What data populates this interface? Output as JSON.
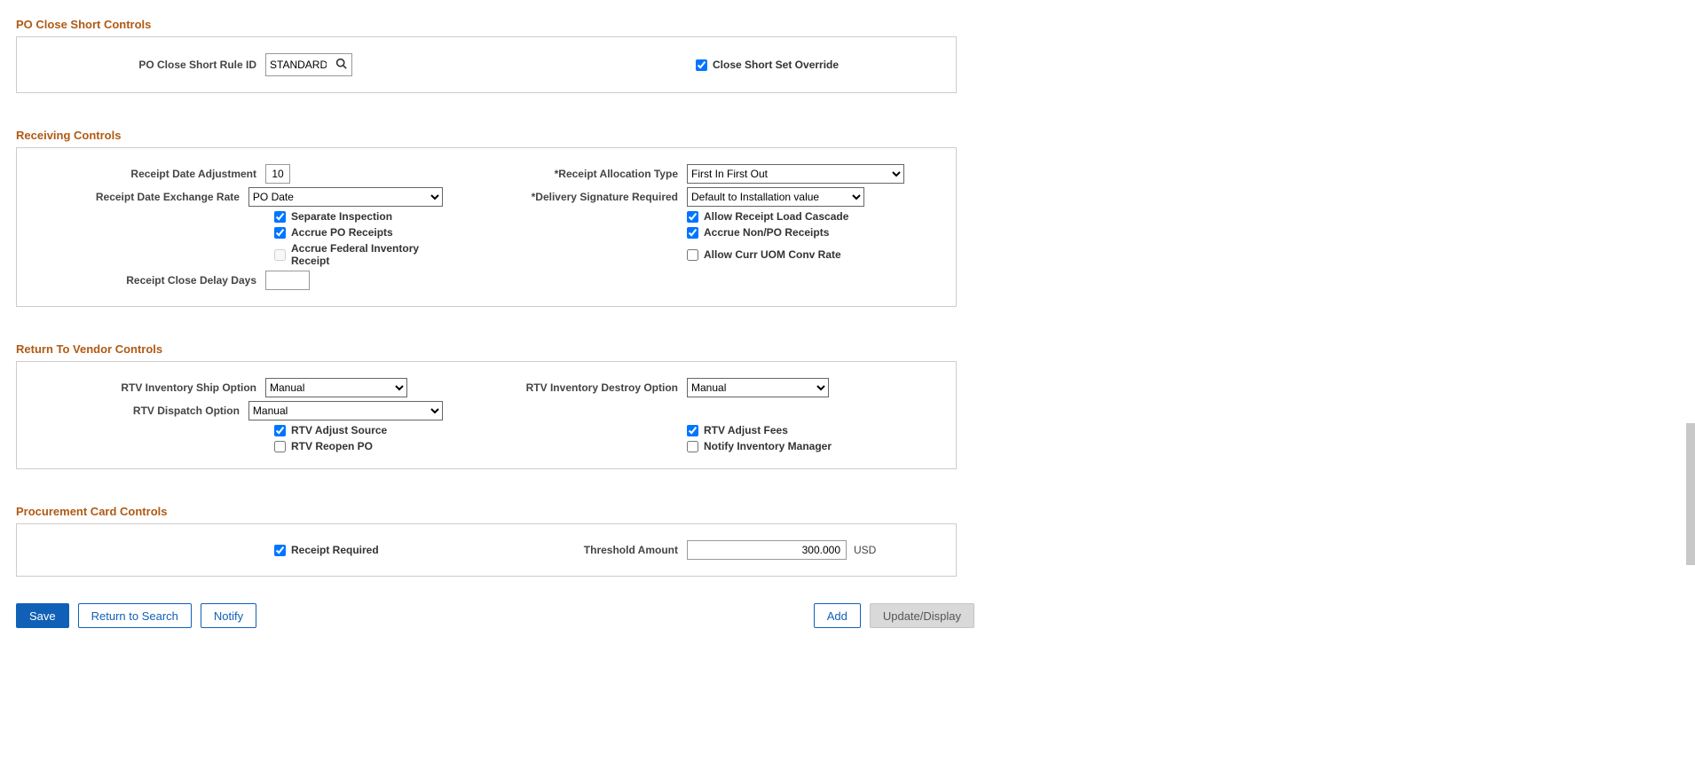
{
  "poCloseShort": {
    "title": "PO Close Short Controls",
    "ruleId_label": "PO Close Short Rule ID",
    "ruleId_value": "STANDARD",
    "closeShortSetOverride_label": "Close Short Set Override",
    "closeShortSetOverride_checked": true
  },
  "receiving": {
    "title": "Receiving Controls",
    "receiptDateAdj_label": "Receipt Date Adjustment",
    "receiptDateAdj_value": "10",
    "receiptAllocType_label": "Receipt Allocation Type",
    "receiptAllocType_value": "First In First Out",
    "receiptDateExchRate_label": "Receipt Date Exchange Rate",
    "receiptDateExchRate_value": "PO Date",
    "deliverySigReq_label": "Delivery Signature Required",
    "deliverySigReq_value": "Default to Installation value",
    "separateInspection_label": "Separate Inspection",
    "separateInspection_checked": true,
    "allowReceiptLoadCascade_label": "Allow Receipt Load Cascade",
    "allowReceiptLoadCascade_checked": true,
    "accruePOReceipts_label": "Accrue PO Receipts",
    "accruePOReceipts_checked": true,
    "accrueNonPOReceipts_label": "Accrue Non/PO Receipts",
    "accrueNonPOReceipts_checked": true,
    "accrueFedInvReceipt_label": "Accrue Federal Inventory Receipt",
    "accrueFedInvReceipt_checked": false,
    "allowCurrUOMConvRate_label": "Allow Curr UOM Conv Rate",
    "allowCurrUOMConvRate_checked": false,
    "receiptCloseDelayDays_label": "Receipt Close Delay Days",
    "receiptCloseDelayDays_value": ""
  },
  "rtv": {
    "title": "Return To Vendor Controls",
    "invShipOption_label": "RTV Inventory Ship Option",
    "invShipOption_value": "Manual",
    "invDestroyOption_label": "RTV Inventory Destroy Option",
    "invDestroyOption_value": "Manual",
    "dispatchOption_label": "RTV Dispatch Option",
    "dispatchOption_value": "Manual",
    "adjustSource_label": "RTV Adjust Source",
    "adjustSource_checked": true,
    "adjustFees_label": "RTV Adjust Fees",
    "adjustFees_checked": true,
    "reopenPO_label": "RTV Reopen PO",
    "reopenPO_checked": false,
    "notifyInvMgr_label": "Notify Inventory Manager",
    "notifyInvMgr_checked": false
  },
  "pcard": {
    "title": "Procurement Card Controls",
    "receiptRequired_label": "Receipt Required",
    "receiptRequired_checked": true,
    "thresholdAmount_label": "Threshold Amount",
    "thresholdAmount_value": "300.000",
    "currency": "USD"
  },
  "footer": {
    "save": "Save",
    "returnToSearch": "Return to Search",
    "notify": "Notify",
    "add": "Add",
    "updateDisplay": "Update/Display"
  }
}
